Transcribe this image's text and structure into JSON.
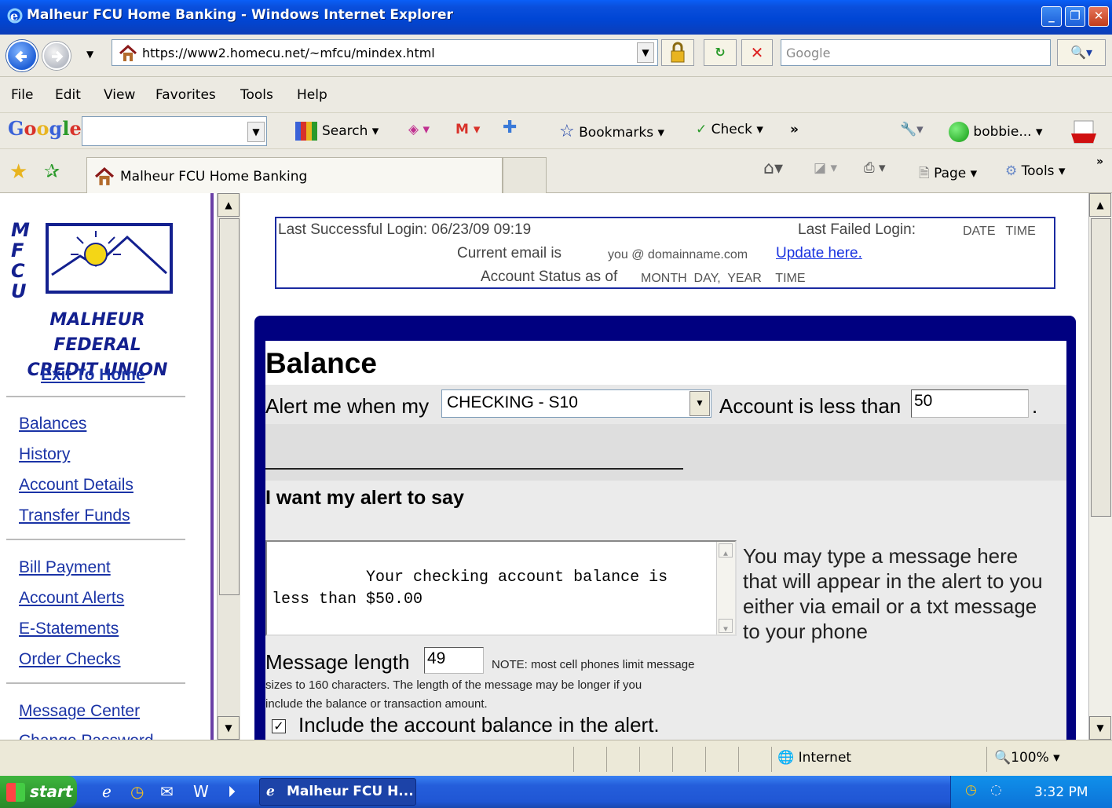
{
  "window": {
    "title": "Malheur FCU Home Banking - Windows Internet Explorer",
    "min": "_",
    "max": "❐",
    "close": "✕"
  },
  "address": {
    "url": "https://www2.homecu.net/~mfcu/mindex.html",
    "search_placeholder": "Google",
    "search_go": "🔍▾"
  },
  "menu": [
    "File",
    "Edit",
    "View",
    "Favorites",
    "Tools",
    "Help"
  ],
  "google_toolbar": {
    "logo": "Google",
    "search": "Search ▾",
    "bookmarks": "Bookmarks ▾",
    "check": "Check ▾",
    "more": "»",
    "user": "bobbie... ▾"
  },
  "tab": {
    "label": "Malheur FCU Home Banking"
  },
  "commands": {
    "page": "Page ▾",
    "tools": "Tools ▾",
    "more": "»"
  },
  "sidebar": {
    "logo_letters": [
      "M",
      "F",
      "C",
      "U"
    ],
    "name_line1": "MALHEUR FEDERAL",
    "name_line2": "CREDIT UNION",
    "exit": "Exit To Home",
    "group1": [
      "Balances",
      "History",
      "Account Details",
      "Transfer Funds"
    ],
    "group2": [
      "Bill Payment",
      "Account Alerts",
      "E-Statements",
      "Order Checks"
    ],
    "group3": [
      "Message Center",
      "Change Password"
    ]
  },
  "login": {
    "last_success_label": "Last Successful Login: 06/23/09 09:19",
    "last_failed_label": "Last Failed Login:",
    "last_failed_value": "DATE   TIME",
    "email_label": "Current email is",
    "email_value": "you @ domainname.com",
    "update_link": "Update here.",
    "status_label": "Account Status as of",
    "status_value": "MONTH  DAY,  YEAR    TIME"
  },
  "alert": {
    "title": "Balance",
    "alert_prefix": "Alert me when my",
    "account_selected": "CHECKING - S10",
    "alert_suffix": "Account is less than",
    "amount": "50",
    "period": ".",
    "say_heading": "I want my alert to say",
    "message": "Your checking account balance is less than $50.00",
    "help_text": "You may type a message here that will appear in the alert to you either via email or a txt message to your phone",
    "length_label": "Message length",
    "length_value": "49",
    "note_line1": "NOTE: most cell phones limit message",
    "note_line2": "sizes to 160 characters. The length of the message may be longer if you",
    "note_line3": "include the balance or transaction amount.",
    "include_label": "Include the account balance in the alert.",
    "include_checked": true
  },
  "status": {
    "zone": "Internet",
    "zoom": "100%"
  },
  "taskbar": {
    "start": "start",
    "task": "Malheur FCU H...",
    "clock": "3:32 PM"
  }
}
